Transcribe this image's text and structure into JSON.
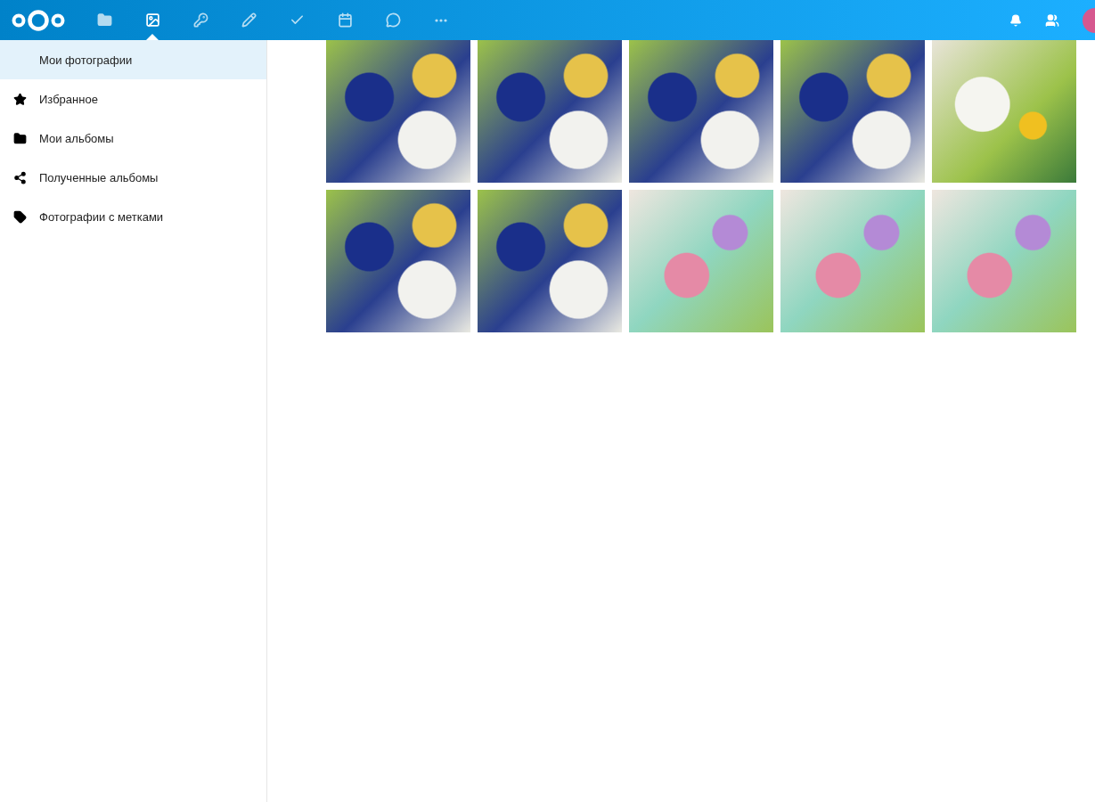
{
  "header": {
    "apps": [
      {
        "kind": "files",
        "selected": false
      },
      {
        "kind": "photos",
        "selected": true
      },
      {
        "kind": "passwords",
        "selected": false
      },
      {
        "kind": "notes",
        "selected": false
      },
      {
        "kind": "tasks",
        "selected": false
      },
      {
        "kind": "calendar",
        "selected": false
      },
      {
        "kind": "talk",
        "selected": false
      },
      {
        "kind": "more",
        "selected": false
      }
    ]
  },
  "sidebar": {
    "items": [
      {
        "label": "Мои фотографии",
        "kind": "none",
        "selected": true
      },
      {
        "label": "Избранное",
        "kind": "star",
        "selected": false
      },
      {
        "label": "Мои альбомы",
        "kind": "folder",
        "selected": false
      },
      {
        "label": "Полученные альбомы",
        "kind": "share",
        "selected": false
      },
      {
        "label": "Фотографии с метками",
        "kind": "tag",
        "selected": false
      }
    ]
  },
  "photos": [
    {
      "kind": "cornflowers"
    },
    {
      "kind": "cornflowers"
    },
    {
      "kind": "cornflowers"
    },
    {
      "kind": "cornflowers"
    },
    {
      "kind": "daisies"
    },
    {
      "kind": "cornflowers"
    },
    {
      "kind": "cornflowers"
    },
    {
      "kind": "pastel"
    },
    {
      "kind": "pastel"
    },
    {
      "kind": "pastel"
    }
  ]
}
